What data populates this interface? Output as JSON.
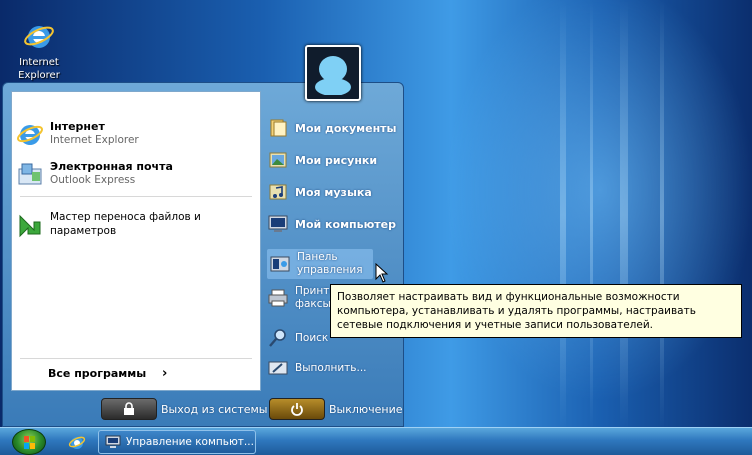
{
  "desktop": {
    "icons": [
      {
        "label": "Internet Explorer",
        "icon": "internet-explorer-icon"
      }
    ]
  },
  "start_menu": {
    "pinned": [
      {
        "title": "Інтернет",
        "subtitle": "Internet Explorer",
        "icon": "internet-explorer-icon"
      },
      {
        "title": "Электронная почта",
        "subtitle": "Outlook Express",
        "icon": "outlook-express-icon"
      }
    ],
    "recent": [
      {
        "title": "Мастер переноса файлов и параметров",
        "icon": "transfer-wizard-icon"
      }
    ],
    "all_programs": "Все программы",
    "all_programs_arrow": "›",
    "places": [
      {
        "label": "Мои документы",
        "icon": "my-documents-icon"
      },
      {
        "label": "Мои рисунки",
        "icon": "my-pictures-icon"
      },
      {
        "label": "Моя музыка",
        "icon": "my-music-icon"
      },
      {
        "label": "Мой компьютер",
        "icon": "my-computer-icon"
      }
    ],
    "settings": [
      {
        "label": "Панель управления",
        "icon": "control-panel-icon"
      },
      {
        "label": "Принте факсы",
        "icon": "printers-icon"
      }
    ],
    "tools": [
      {
        "label": "Поиск",
        "icon": "search-icon"
      },
      {
        "label": "Выполнить...",
        "icon": "run-icon"
      }
    ],
    "logoff_label": "Выход из системы",
    "shutdown_label": "Выключение"
  },
  "tooltip": {
    "text": "Позволяет настраивать вид и функциональные возможности компьютера, устанавливать и удалять программы, настраивать сетевые подключения и учетные записи пользователей."
  },
  "taskbar": {
    "task_label": "Управление компьют..."
  },
  "colors": {
    "menu_blue": "#3a7bb8",
    "tooltip_bg": "#ffffe1",
    "shutdown_orange": "#b78d2a"
  }
}
